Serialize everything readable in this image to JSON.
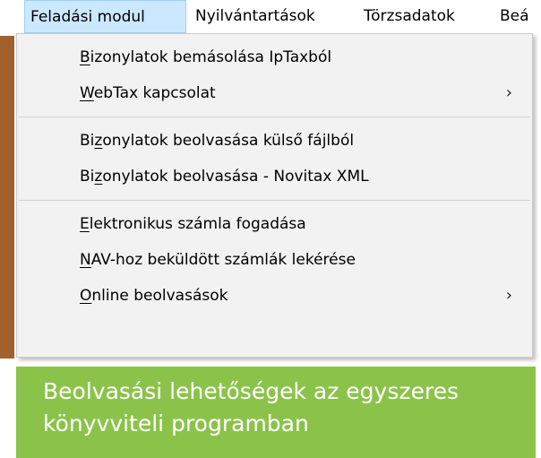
{
  "menubar": {
    "items": [
      {
        "label": "Feladási modul"
      },
      {
        "label": "Nyilvántartások"
      },
      {
        "label": "Törzsadatok"
      },
      {
        "label": "Beá"
      }
    ]
  },
  "menu": {
    "items": [
      {
        "pre": "",
        "ul": "B",
        "post": "izonylatok bemásolása IpTaxból",
        "arrow": ""
      },
      {
        "pre": "",
        "ul": "W",
        "post": "ebTax kapcsolat",
        "arrow": "›"
      },
      {
        "pre": "Bi",
        "ul": "z",
        "post": "onylatok beolvasása külső fájlból",
        "arrow": ""
      },
      {
        "pre": "Bi",
        "ul": "z",
        "post": "onylatok beolvasása - Novitax XML",
        "arrow": ""
      },
      {
        "pre": "",
        "ul": "E",
        "post": "lektronikus számla fogadása",
        "arrow": ""
      },
      {
        "pre": "",
        "ul": "N",
        "post": "AV-hoz beküldött számlák lekérése",
        "arrow": ""
      },
      {
        "pre": "",
        "ul": "O",
        "post": "nline beolvasások",
        "arrow": "›"
      }
    ]
  },
  "caption": {
    "line1": "Beolvasási lehetőségek az egyszeres",
    "line2": "könyvviteli programban"
  }
}
